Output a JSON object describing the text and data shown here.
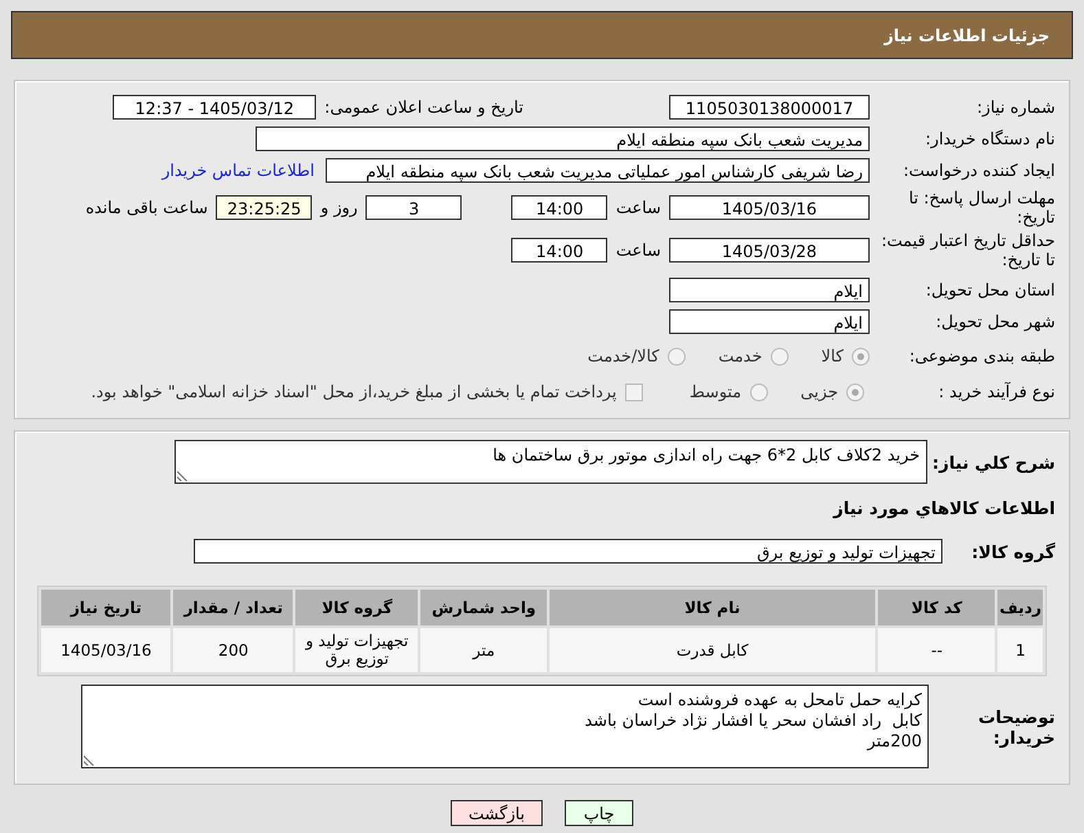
{
  "header": {
    "title": "جزئیات اطلاعات نیاز"
  },
  "details": {
    "need_number": {
      "label": "شماره نیاز:",
      "value": "1105030138000017"
    },
    "announce": {
      "label": "تاریخ و ساعت اعلان عمومی:",
      "value": "1405/03/12 - 12:37"
    },
    "buyer_org": {
      "label": "نام دستگاه خریدار:",
      "value": "مدیریت شعب بانک سپه منطقه ایلام"
    },
    "requester": {
      "label": "ایجاد کننده درخواست:",
      "value": "رضا شریفی کارشناس امور عملیاتی مدیریت شعب بانک سپه منطقه ایلام",
      "link": "اطلاعات تماس خریدار"
    },
    "response_deadline": {
      "label": "مهلت ارسال پاسخ: تا تاریخ:",
      "date": "1405/03/16",
      "time_label": "ساعت",
      "time": "14:00",
      "days": "3",
      "days_label": "روز و",
      "remaining": "23:25:25",
      "remaining_label": "ساعت باقی مانده"
    },
    "price_validity": {
      "label": "حداقل تاریخ اعتبار قیمت: تا تاریخ:",
      "date": "1405/03/28",
      "time_label": "ساعت",
      "time": "14:00"
    },
    "province": {
      "label": "استان محل تحویل:",
      "value": "ایلام"
    },
    "city": {
      "label": "شهر محل تحویل:",
      "value": "ایلام"
    },
    "category": {
      "label": "طبقه بندی موضوعی:",
      "options": [
        {
          "label": "کالا",
          "selected": true
        },
        {
          "label": "خدمت",
          "selected": false
        },
        {
          "label": "کالا/خدمت",
          "selected": false
        }
      ]
    },
    "process": {
      "label": "نوع فرآیند خرید :",
      "options": [
        {
          "label": "جزیی",
          "selected": true
        },
        {
          "label": "متوسط",
          "selected": false
        }
      ],
      "payment": {
        "label": "پرداخت تمام یا بخشی از مبلغ خرید،از محل \"اسناد خزانه اسلامی\" خواهد بود.",
        "checked": false
      }
    }
  },
  "need": {
    "summary": {
      "label": "شرح کلي نياز:",
      "value": "خرید 2کلاف کابل 2*6 جهت راه اندازی موتور برق ساختمان ها"
    },
    "goods_heading": "اطلاعات کالاهاي مورد نياز",
    "goods_group": {
      "label": "گروه کالا:",
      "value": "تجهیزات تولید و توزیع برق"
    },
    "table": {
      "columns": [
        "ردیف",
        "کد کالا",
        "نام کالا",
        "واحد شمارش",
        "گروه کالا",
        "تعداد / مقدار",
        "تاریخ نیاز"
      ],
      "rows": [
        [
          "1",
          "--",
          "کابل قدرت",
          "متر",
          "تجهیزات تولید و توزیع برق",
          "200",
          "1405/03/16"
        ]
      ]
    },
    "buyer_notes": {
      "label": "توضیحات خریدار:",
      "lines": [
        "کرایه حمل تامحل به عهده فروشنده است",
        "کابل  راد افشان سحر یا افشار نژاد خراسان باشد",
        "200متر"
      ]
    }
  },
  "buttons": [
    {
      "label": "چاپ",
      "kind": "print"
    },
    {
      "label": "بازگشت",
      "kind": "back"
    }
  ]
}
